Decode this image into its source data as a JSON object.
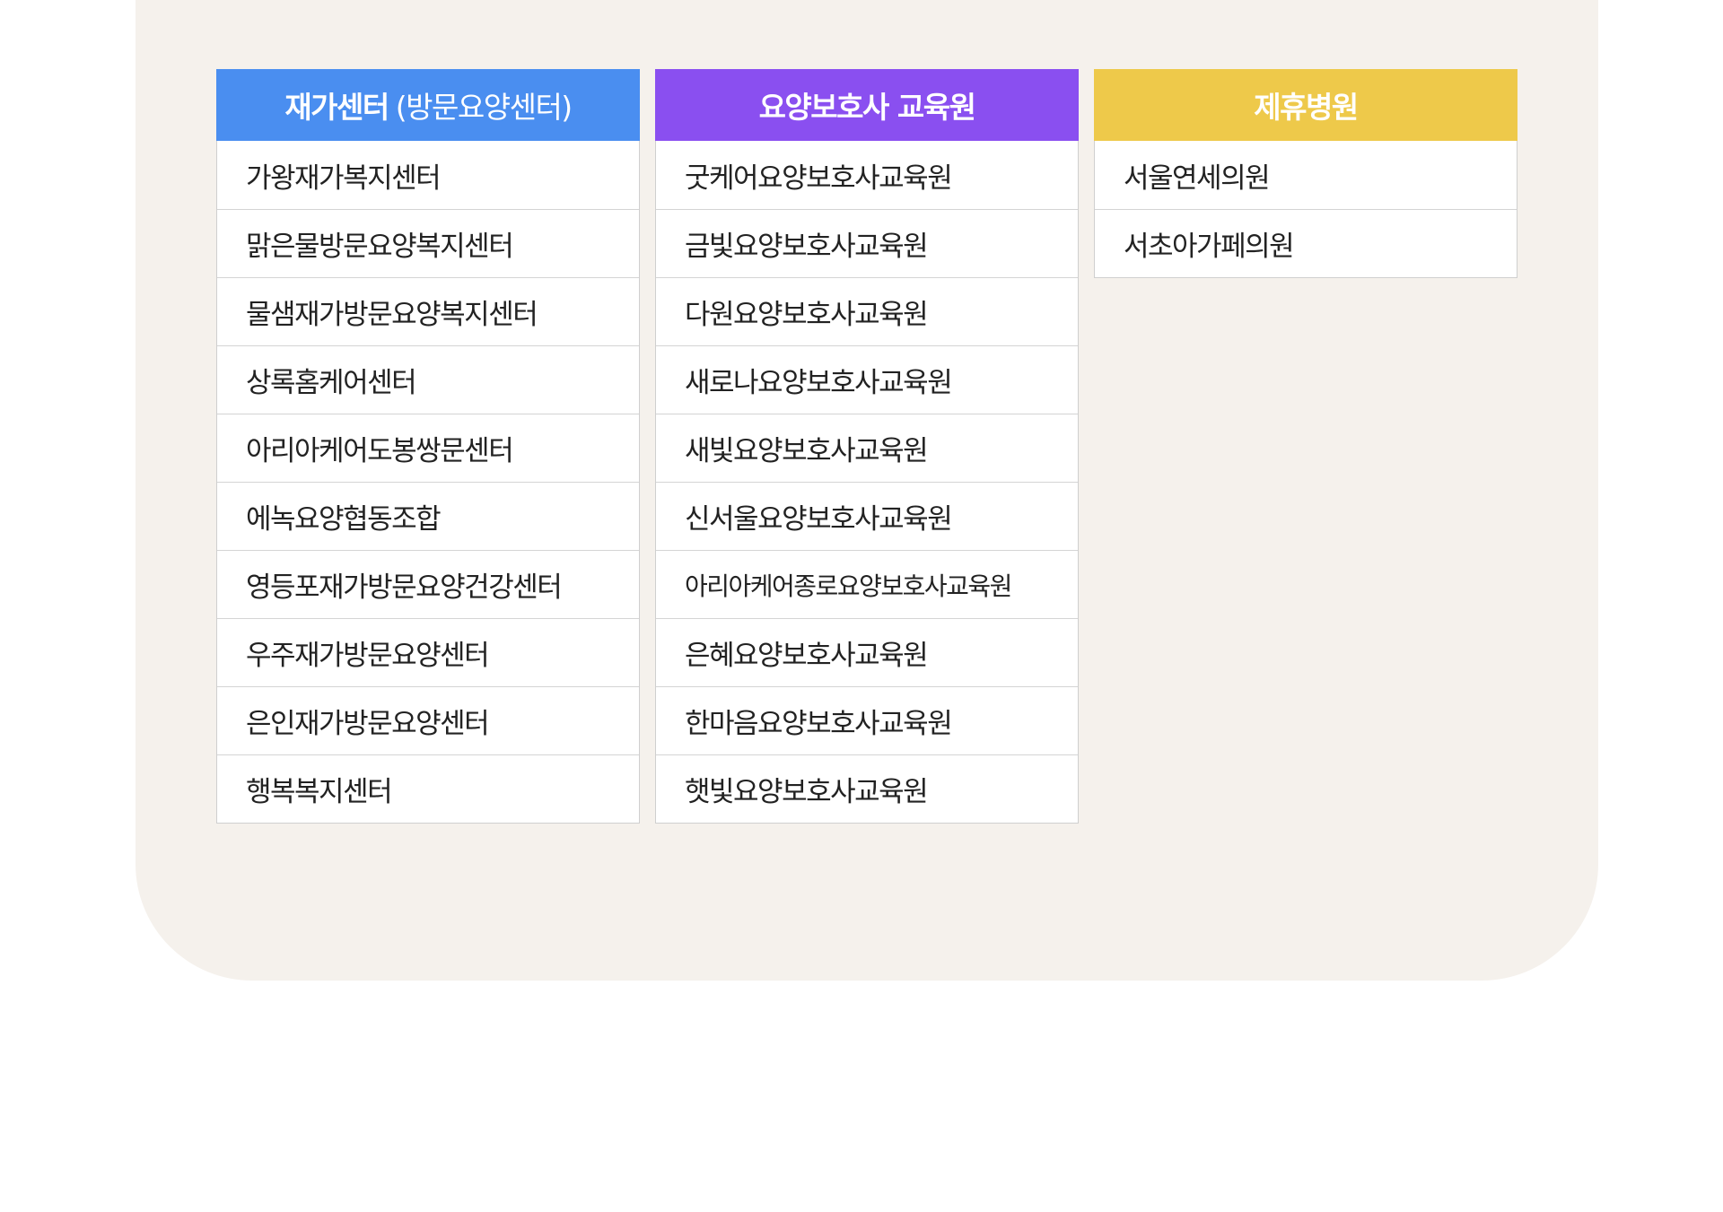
{
  "colors": {
    "panel_bg": "#f5f1ec",
    "header_blue": "#4a8ef0",
    "header_purple": "#8a4ff0",
    "header_yellow": "#eec94a"
  },
  "columns": [
    {
      "title": "재가센터",
      "subtitle": "(방문요양센터)",
      "items": [
        "가왕재가복지센터",
        "맑은물방문요양복지센터",
        "물샘재가방문요양복지센터",
        "상록홈케어센터",
        "아리아케어도봉쌍문센터",
        "에녹요양협동조합",
        "영등포재가방문요양건강센터",
        "우주재가방문요양센터",
        "은인재가방문요양센터",
        "행복복지센터"
      ]
    },
    {
      "title": "요양보호사 교육원",
      "items": [
        "굿케어요양보호사교육원",
        "금빛요양보호사교육원",
        "다원요양보호사교육원",
        "새로나요양보호사교육원",
        "새빛요양보호사교육원",
        "신서울요양보호사교육원",
        "아리아케어종로요양보호사교육원",
        "은혜요양보호사교육원",
        "한마음요양보호사교육원",
        "햇빛요양보호사교육원"
      ]
    },
    {
      "title": "제휴병원",
      "items": [
        "서울연세의원",
        "서초아가페의원"
      ]
    }
  ]
}
